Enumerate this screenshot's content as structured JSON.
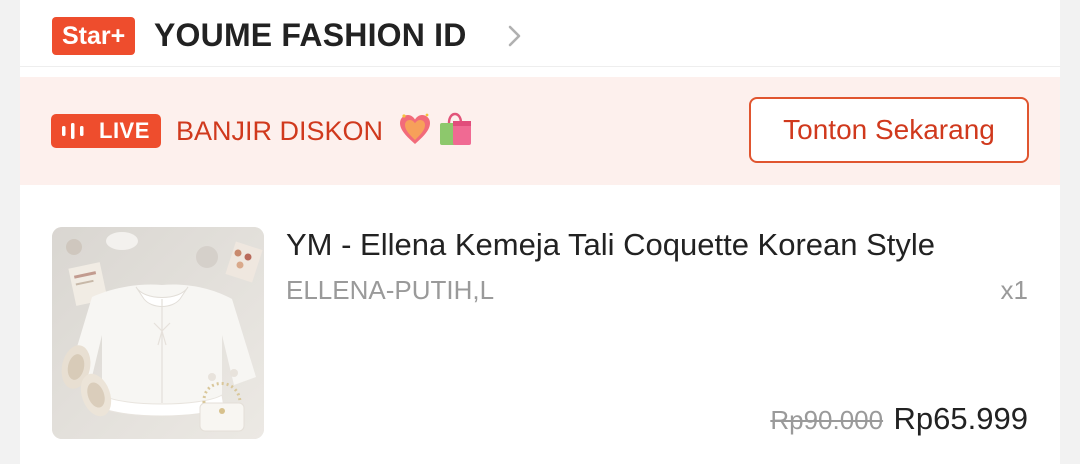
{
  "shop": {
    "badge": "Star+",
    "name": "YOUME FASHION ID"
  },
  "live": {
    "badge_label": "LIVE",
    "promo_text": "BANJIR DISKON",
    "emojis": [
      "sparkling-heart",
      "shopping-bag"
    ],
    "watch_button": "Tonton Sekarang"
  },
  "product": {
    "name": "YM - Ellena Kemeja Tali Coquette Korean Style",
    "variation": "ELLENA-PUTIH,L",
    "quantity": "x1",
    "price_original": "Rp90.000",
    "price_final": "Rp65.999"
  },
  "colors": {
    "brand": "#ee4d2d",
    "banner_bg": "#fdf0ed",
    "promo_text": "#d0391d",
    "muted": "#9a9a9a"
  }
}
